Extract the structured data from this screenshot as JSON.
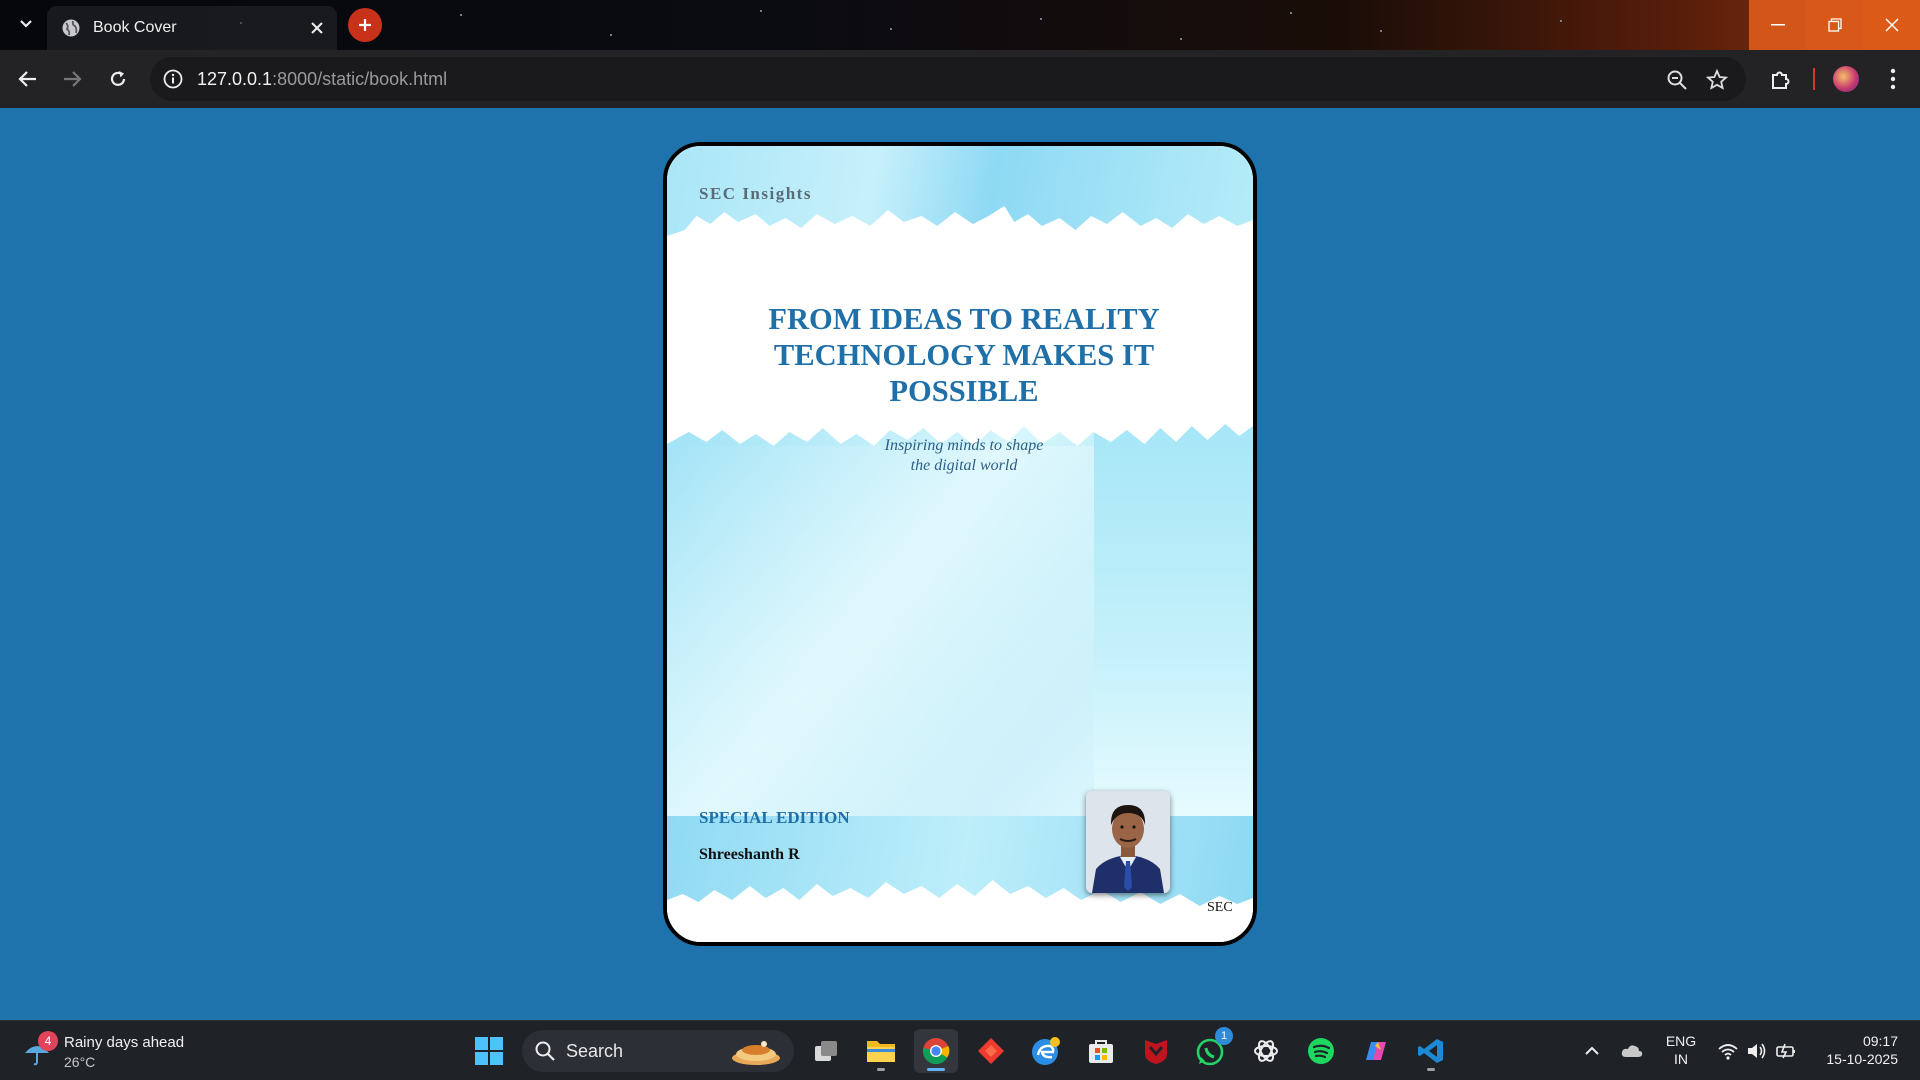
{
  "browser": {
    "tab_title": "Book Cover",
    "url_host": "127.0.0.1",
    "url_rest": ":8000/static/book.html"
  },
  "cover": {
    "brand": "SEC Insights",
    "headline_lines": [
      "FROM IDEAS TO REALITY",
      "TECHNOLOGY MAKES IT",
      "POSSIBLE"
    ],
    "tagline_lines": [
      "Inspiring minds to shape",
      "the digital world"
    ],
    "edition": "SPECIAL EDITION",
    "author": "Shreeshanth R",
    "footer_mark": "SEC",
    "accent_color": "#1f6fa8",
    "background_color": "#1e73ac"
  },
  "taskbar": {
    "weather_title": "Rainy days ahead",
    "weather_temp": "26°C",
    "weather_badge": "4",
    "search_label": "Search",
    "whatsapp_badge": "1",
    "lang_line1": "ENG",
    "lang_line2": "IN",
    "time": "09:17",
    "date": "15-10-2025"
  }
}
